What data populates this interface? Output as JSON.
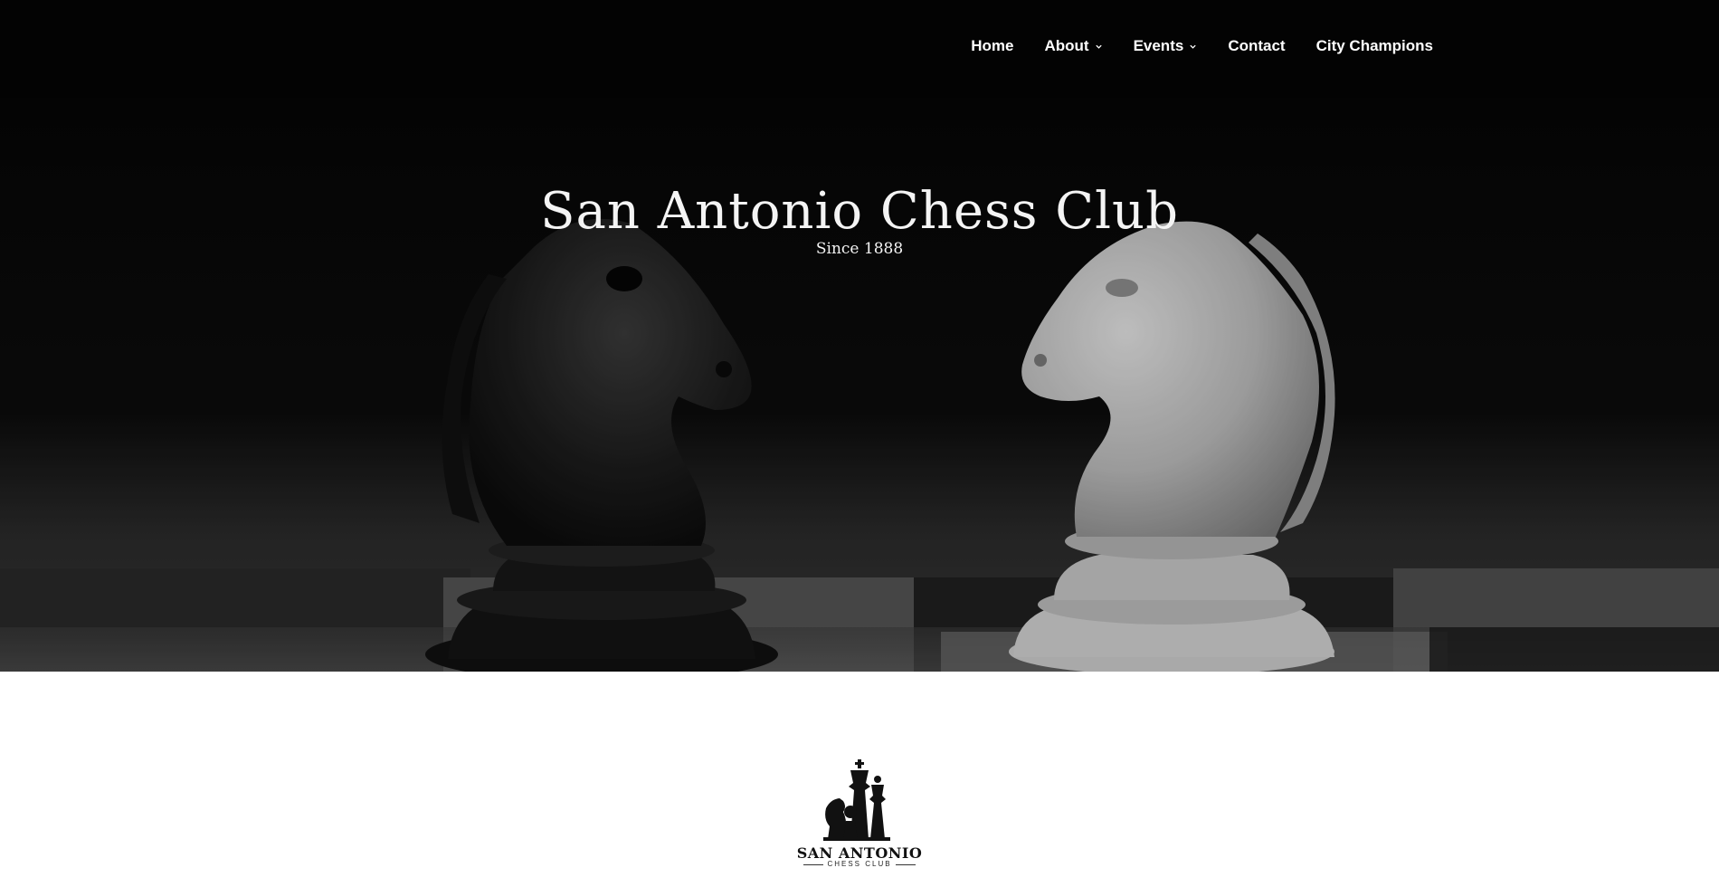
{
  "nav": {
    "items": [
      {
        "label": "Home",
        "has_dropdown": false
      },
      {
        "label": "About",
        "has_dropdown": true
      },
      {
        "label": "Events",
        "has_dropdown": true
      },
      {
        "label": "Contact",
        "has_dropdown": false
      },
      {
        "label": "City Champions",
        "has_dropdown": false
      }
    ]
  },
  "hero": {
    "title": "San Antonio Chess Club",
    "subtitle": "Since 1888",
    "image": "chess-knights-photo"
  },
  "logo": {
    "name": "SAN ANTONIO",
    "tagline": "CHESS CLUB",
    "icon": "chess-pieces-logo-icon"
  },
  "colors": {
    "header_bg": "#030303",
    "hero_text": "#f4f4f4",
    "page_bg": "#ffffff"
  }
}
